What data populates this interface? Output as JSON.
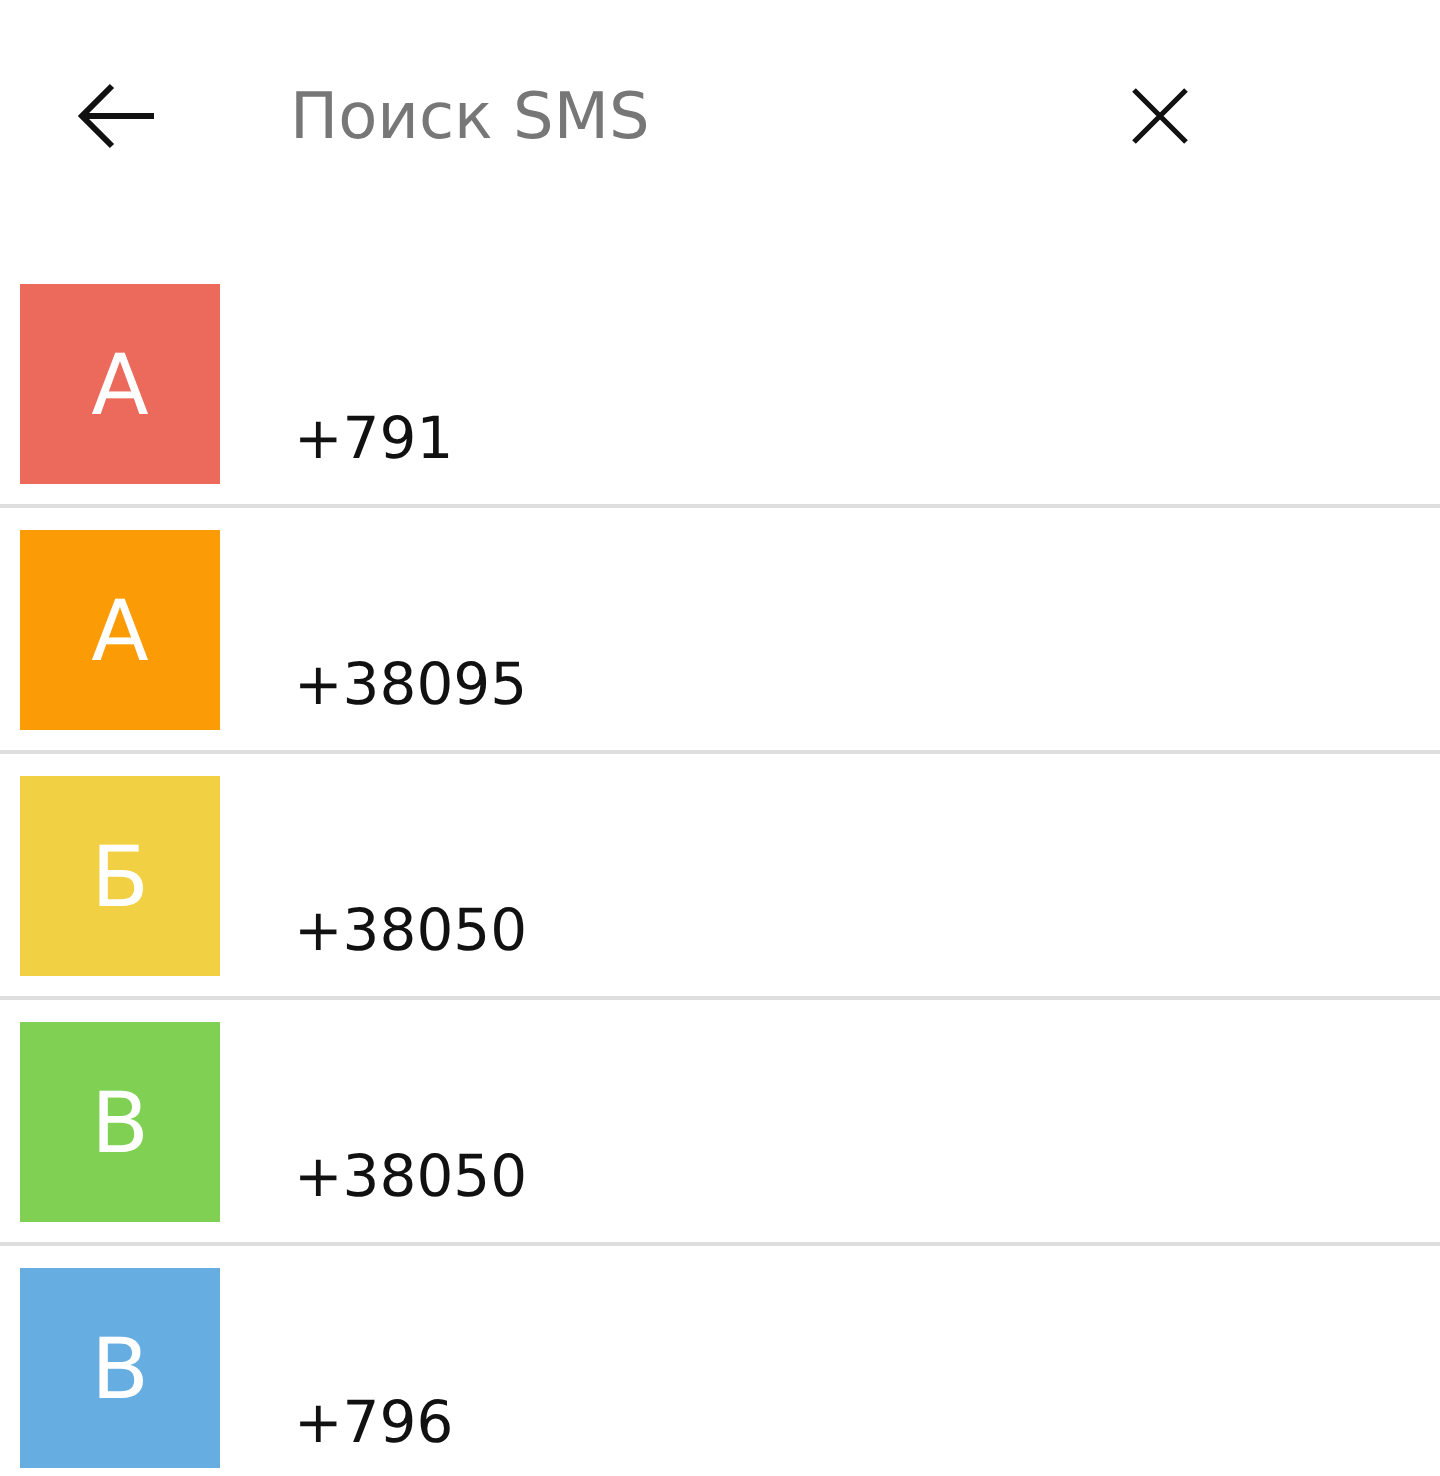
{
  "search": {
    "placeholder": "Поиск SMS"
  },
  "contacts": [
    {
      "initial": "А",
      "color": "#eb6a5c",
      "phone": "+791"
    },
    {
      "initial": "А",
      "color": "#fb9c06",
      "phone": "+38095"
    },
    {
      "initial": "Б",
      "color": "#f1d043",
      "phone": "+38050"
    },
    {
      "initial": "В",
      "color": "#7fd053",
      "phone": "+38050"
    },
    {
      "initial": "В",
      "color": "#66ade2",
      "phone": "+796"
    }
  ]
}
